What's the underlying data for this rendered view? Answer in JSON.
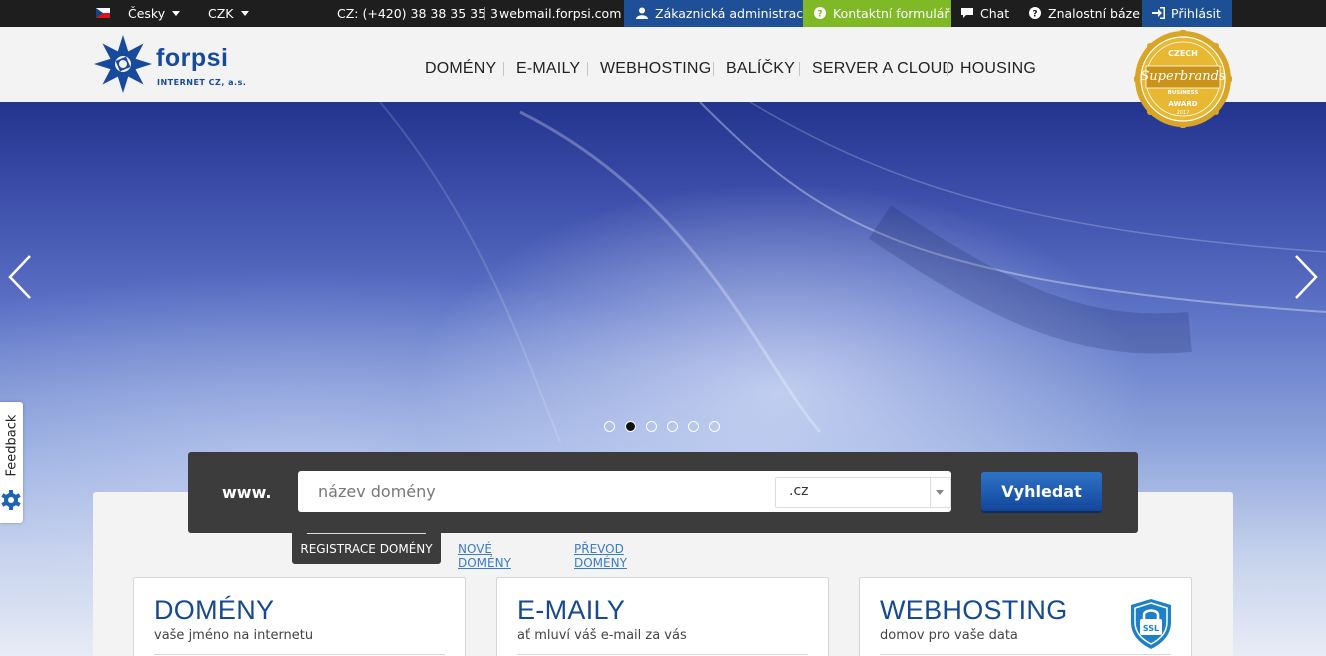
{
  "topbar": {
    "language": "Česky",
    "currency": "CZK",
    "phone": "CZ: (+420) 38 38 35 35 3",
    "webmail": "webmail.forpsi.com",
    "customer_admin": "Zákaznická administrace",
    "contact_form": "Kontaktní formulář",
    "chat": "Chat",
    "knowledge_base": "Znalostní báze",
    "login": "Přihlásit",
    "colors": {
      "customer_admin_bg": "#1f4f97",
      "contact_form_bg": "#7fba26",
      "login_bg": "#1d4f94"
    }
  },
  "header": {
    "logo_text": "forpsi",
    "logo_sub": "INTERNET CZ, a.s.",
    "nav": [
      "DOMÉNY",
      "E-MAILY",
      "WEBHOSTING",
      "BALÍČKY",
      "SERVER A CLOUD",
      "HOUSING"
    ],
    "badge": {
      "top": "CZECH",
      "main": "Superbrands",
      "sub1": "BUSINESS",
      "sub2": "AWARD",
      "year": "2017"
    }
  },
  "slider": {
    "dots": 6,
    "active_dot": 2,
    "prev_icon": "chevron-left-icon",
    "next_icon": "chevron-right-icon"
  },
  "search": {
    "prefix": "www.",
    "placeholder": "název domény",
    "tld": ".cz",
    "button": "Vyhledat"
  },
  "tabs": {
    "active": "REGISTRACE DOMÉNY",
    "new_domains": "NOVÉ DOMÉNY",
    "transfer": "PŘEVOD DOMÉNY"
  },
  "cards": [
    {
      "title": "DOMÉNY",
      "subtitle": "vaše jméno na internetu"
    },
    {
      "title": "E-MAILY",
      "subtitle": "ať mluví váš e-mail za vás"
    },
    {
      "title": "WEBHOSTING",
      "subtitle": "domov pro vaše data",
      "icon_text": "SSL"
    }
  ],
  "feedback": {
    "label": "Feedback"
  }
}
